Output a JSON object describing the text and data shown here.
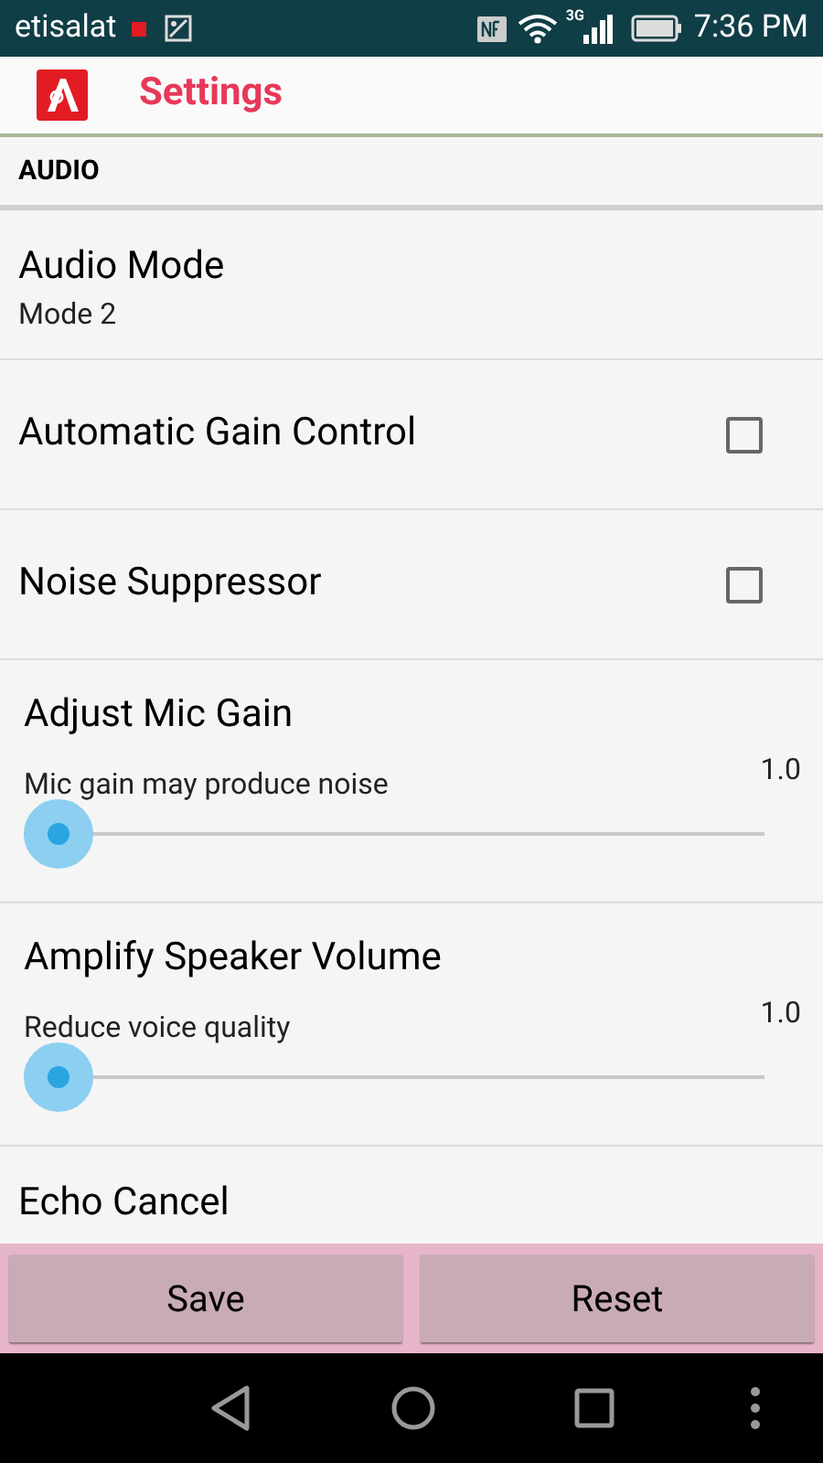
{
  "status_bar": {
    "carrier": "etisalat",
    "time": "7:36 PM",
    "network": "3G"
  },
  "toolbar": {
    "title": "Settings"
  },
  "section": "AUDIO",
  "items": [
    {
      "kind": "list",
      "title": "Audio Mode",
      "summary": "Mode 2"
    },
    {
      "kind": "checkbox",
      "title": "Automatic Gain Control",
      "checked": false
    },
    {
      "kind": "checkbox",
      "title": "Noise Suppressor",
      "checked": false
    },
    {
      "kind": "slider",
      "title": "Adjust Mic Gain",
      "summary": "Mic gain may produce noise",
      "reading": "1.0",
      "level": 0
    },
    {
      "kind": "slider",
      "title": "Amplify Speaker Volume",
      "summary": "Reduce voice quality",
      "reading": "1.0",
      "level": 0
    },
    {
      "kind": "list",
      "title": "Echo Cancel"
    }
  ],
  "buttons": [
    "Save",
    "Reset"
  ]
}
